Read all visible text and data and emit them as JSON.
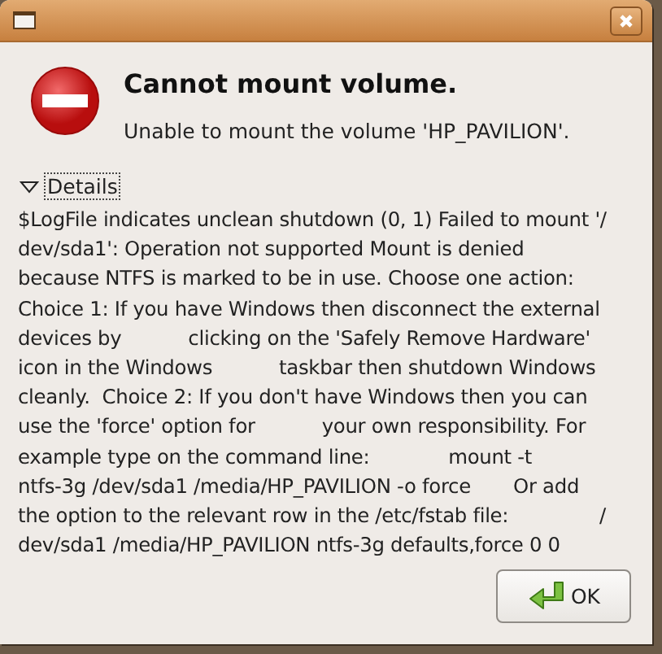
{
  "dialog": {
    "title": "Cannot mount volume.",
    "message": "Unable to mount the volume 'HP_PAVILION'."
  },
  "details": {
    "label": "Details",
    "expanded": true,
    "lines": [
      "$LogFile indicates unclean shutdown (0, 1) Failed to mount '/",
      "dev/sda1': Operation not supported Mount is denied",
      "because NTFS is marked to be in use. Choose one action:",
      "Choice 1: If you have Windows then disconnect the external",
      "devices by           clicking on the 'Safely Remove Hardware'",
      "icon in the Windows           taskbar then shutdown Windows",
      "cleanly.  Choice 2: If you don't have Windows then you can",
      "use the 'force' option for           your own responsibility. For",
      "example type on the command line:             mount -t",
      "ntfs-3g /dev/sda1 /media/HP_PAVILION -o force       Or add",
      "the option to the relevant row in the /etc/fstab file:               /",
      "dev/sda1 /media/HP_PAVILION ntfs-3g defaults,force 0 0"
    ]
  },
  "buttons": [
    {
      "label": "OK"
    }
  ]
}
